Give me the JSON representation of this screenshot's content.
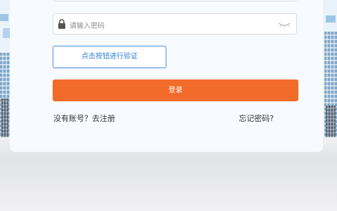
{
  "login": {
    "password_placeholder": "请输入密码",
    "verify_button": "点击按钮进行验证",
    "login_button": "登录",
    "register_link": "没有账号？去注册",
    "forgot_link": "忘记密码?"
  },
  "colors": {
    "accent_orange": "#f26b2a",
    "verify_blue": "#4a90d9"
  },
  "icons": [
    "lock-icon",
    "eye-closed-icon"
  ]
}
